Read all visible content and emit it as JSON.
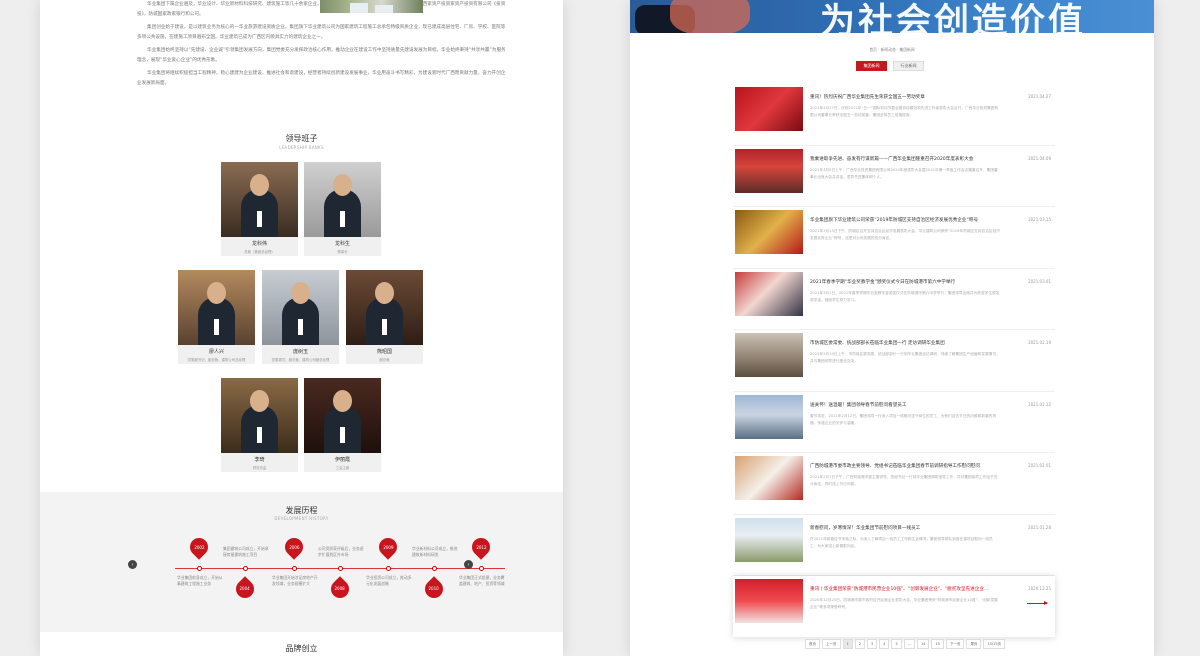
{
  "left": {
    "about_paragraphs": [
      "华业集团下属企业遍及，华业设计、华业新材料科技研究、建筑施工等几十余家企业。经过投国广西投建国家技术有限公司，经投资国广西家资产投资家资产投资有限公司《投资投》，防城国家政家银行和公司。",
      "集团创业始于建设，是以建筑业务为核心的一华业旅游建设资质企业。集团旗下华业建筑公司为国家建筑工程施工总承包特级资质企业，现已建成高层住宅、厂房、学校、医院等多项公共设施，在建施工项目遍布全国。华业建筑已成为广西区内颇具实力的建筑企业之一。",
      "华业集团始终坚持以“先建设、企业诚”引领集团发展方向，集团党委充分发挥政治核心作用，推动企业在建设工作中坚持质量先建设发展为目标，华业始终秉持“共享共赢”为服务理念，展现“华业爱心企业”的优秀形象。",
      "华业集团将继续积极担当工程精神，稳心建建为企业建设，推进社会和谐建设，经营者持续创新建设发展事业，华业用奋斗书写精彩，为建设新时代广西而贡献力量，奋力开创企业发展新局面。"
    ],
    "leadership": {
      "title": "领导班子",
      "subtitle": "LEADERSHIP RANKS",
      "members": [
        {
          "name": "龙科伟",
          "role": "总裁（集团总经理）"
        },
        {
          "name": "龙科生",
          "role": "董事长"
        },
        {
          "name": "廖人兴",
          "role": "党委副书记、副总裁、建筑公司总经理"
        },
        {
          "name": "庞树玉",
          "role": "党委委员、副总裁、建筑公司副总经理"
        },
        {
          "name": "熊昭国",
          "role": "副总裁"
        },
        {
          "name": "李琦",
          "role": "财务总监"
        },
        {
          "name": "伊丽霞",
          "role": "工会主席"
        }
      ]
    },
    "history": {
      "title": "发展历程",
      "subtitle": "DEVELOPMENT HISTORY",
      "prev_icon": "‹",
      "next_icon": "›",
      "events": [
        {
          "year": "2002",
          "text": "华业集团前身成立，开始从事建筑工程施工业务"
        },
        {
          "year": "2004",
          "text": "集团建筑公司成立，开始承接房屋建筑施工项目"
        },
        {
          "year": "2006",
          "text": "华业集团开始涉足房地产开发领域，业务规模扩大"
        },
        {
          "year": "2008",
          "text": "公司资质获评级后，业务逐步扩展到区外市场"
        },
        {
          "year": "2009",
          "text": "华业投资公司成立，推动多元化发展战略"
        },
        {
          "year": "2010",
          "text": "华业新材料公司成立，推进建筑新材料研发"
        },
        {
          "year": "2012",
          "text": "华业集团正式组建，业务覆盖建筑、地产、投资等领域"
        },
        {
          "year": "2016",
          "text": "集团获评“广西优秀企业”，品牌影响力不断提升"
        }
      ]
    },
    "brand": {
      "title": "品牌创立"
    }
  },
  "right": {
    "banner_text": "为社会创造价值",
    "breadcrumb": "首页 · 新闻动态 · 集团新闻",
    "tabs": [
      {
        "label": "集团新闻",
        "active": true
      },
      {
        "label": "行业新闻",
        "active": false
      }
    ],
    "news": [
      {
        "title": "重讯！热烈庆祝广西华业集团先生荣获全国五一劳动奖章",
        "date": "2021.04.27",
        "summary": "2021年4月27日，庆祝2021年“五一”国际劳动节暨全国劳动模范和先进工作者表彰大会召开，广西华业投资集团有限公司董事长荣获全国五一劳动奖章，集团全体员工倍感振奋。",
        "thumb": "red"
      },
      {
        "title": "我乘进取争先进、奋发有行谋新篇——广西华业集团隆重召开2020年度表彰大会",
        "date": "2021.04.09",
        "summary": "2021年4月9日上午，广西华业投资集团有限公司2020年度表彰大会暨2021年第一季度工作会议隆重召开，集团董事长出席大会并讲话，表彰先进集体和个人。",
        "thumb": "hall"
      },
      {
        "title": "华业集团旗下华业建筑公司荣获“2019年防城区支持自治区经济发展优秀企业”称号",
        "date": "2021.03.15",
        "summary": "2021年3月15日下午，防城区召开支持自治区经济发展表彰大会，华业建筑公司荣获“2019年防城区支持自治区经济发展优秀企业”称号，这是对公司发展的充分肯定。",
        "thumb": "plaque"
      },
      {
        "title": "2021年春季学期“华业奖教学金”颁奖仪式今日在防城港市第六中学举行",
        "date": "2021.03.01",
        "summary": "2021年3月1日，2021年春季学期华业奖教学金颁奖仪式在防城港市第六中学举行，集团领导出席并为获奖学生颁发奖学金，鼓励学生努力学习。",
        "thumb": "ceremony"
      },
      {
        "title": "市防城区委常委、统战部部长莅临华业集团一行 走访调研华业集团",
        "date": "2021.02.19",
        "summary": "2021年2月19日上午，市防城区委常委、统战部部长一行到华业集团走访调研，详细了解集团生产经营和发展情况，并与集团领导进行座谈交流。",
        "thumb": "meeting"
      },
      {
        "title": "送关怀！送温暖！集团领导春节前慰问看望员工",
        "date": "2021.02.12",
        "summary": "春节将至，2021年2月12日，集团领导一行深入项目一线慰问坚守岗位的员工，为他们送去节日的问候和新春的祝福，传递企业的关怀与温暖。",
        "thumb": "building"
      },
      {
        "title": "广西防城港市委市政主要领导、党组书记莅临华业集团春节前调研指导工作慰问慰问",
        "date": "2021.02.01",
        "summary": "2021年2月1日下午，广西防城港市委主要领导、党组书记一行到华业集团调研指导工作，并对集团各项工作给予充分肯定，同时送上节日问候。",
        "thumb": "visit"
      },
      {
        "title": "新春慰问，岁寒情深！华业集团节前慰问项目一线员工",
        "date": "2021.01.28",
        "summary": "在2021年新春佳节来临之际，为深入了解项目一线员工工作和生活情况，集团领导带队到各在建项目慰问一线员工，为大家送上新春慰问品。",
        "thumb": "site"
      },
      {
        "title": "重讯丨华业集团荣获“防城港市民营企业10强”、“创新发展企业”、“脱贫攻坚先进企业”称号",
        "date": "2020.12.25",
        "summary": "2020年12月25日，防城港市委市政府召开民营企业表彰大会，华业集团荣获“防城港市民营企业10强”、“创新发展企业”等多项荣誉称号。",
        "thumb": "award"
      }
    ],
    "pagination": [
      "首页",
      "上一页",
      "1",
      "2",
      "3",
      "4",
      "5",
      "...",
      "14",
      "15",
      "下一页",
      "尾页",
      "15/15页"
    ]
  }
}
